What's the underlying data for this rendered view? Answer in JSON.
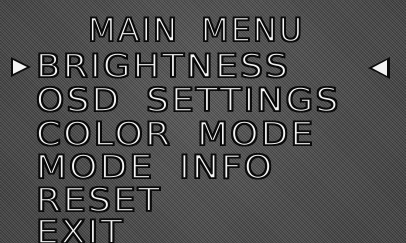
{
  "osd": {
    "title": "MAIN MENU",
    "selected_index": 0,
    "items": [
      {
        "label": "BRIGHTNESS"
      },
      {
        "label": "OSD SETTINGS"
      },
      {
        "label": "COLOR MODE"
      },
      {
        "label": "MODE INFO"
      },
      {
        "label": "RESET"
      },
      {
        "label": "EXIT"
      }
    ],
    "indicators": {
      "selection_pointer": "right-triangle-icon",
      "adjust_pointer": "left-triangle-icon"
    },
    "colors": {
      "text_fill": "#f4f4f4",
      "text_outline": "#0b0b0b",
      "background": "#4a4a4a"
    }
  }
}
